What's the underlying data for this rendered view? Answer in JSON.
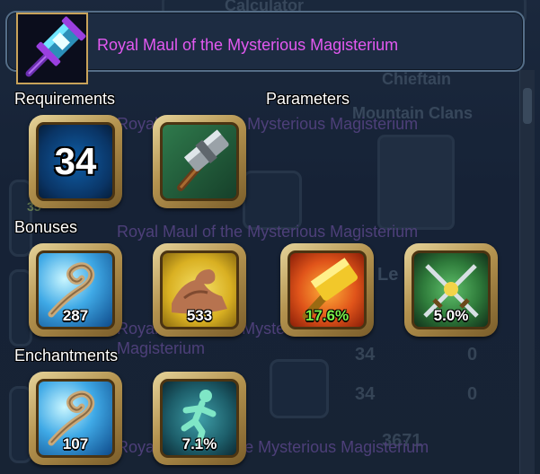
{
  "background": {
    "header_fragment": "Calculator",
    "chieftain": "Chieftain",
    "clan": "Mountain Clans",
    "level_fragment": "Le",
    "num_35": "35",
    "rows": [
      {
        "left": "34",
        "right": "0"
      },
      {
        "left": "34",
        "right": "0"
      }
    ],
    "bottom_num": "3671",
    "ghost_titles": [
      "Royal Maul of the Mysterious Magisterium",
      "Royal Maul of the Mysterious Magisterium",
      "Royal Star of the Mysterious",
      "Magisterium",
      "Royal Slayer of the Mysterious Magisterium"
    ]
  },
  "tooltip": {
    "item_name": "Royal Maul of the Mysterious Magisterium",
    "item_icon": "maul-icon",
    "sections": {
      "requirements": "Requirements",
      "parameters": "Parameters",
      "bonuses": "Bonuses",
      "enchantments": "Enchantments"
    },
    "requirement_level": "34",
    "parameter_icon": "hammer-icon",
    "bonuses": [
      {
        "icon": "magic-swirl-icon",
        "value": "287"
      },
      {
        "icon": "strength-arm-icon",
        "value": "533"
      },
      {
        "icon": "golden-hammer-icon",
        "value": "17.6%"
      },
      {
        "icon": "crossed-swords-icon",
        "value": "5.0%"
      }
    ],
    "enchantments": [
      {
        "icon": "magic-swirl-icon",
        "value": "107"
      },
      {
        "icon": "running-man-icon",
        "value": "7.1%"
      }
    ]
  },
  "colors": {
    "title_text": "#e259f0",
    "frame_gold": "#b3924e",
    "green_stat": "#7cf24a"
  }
}
